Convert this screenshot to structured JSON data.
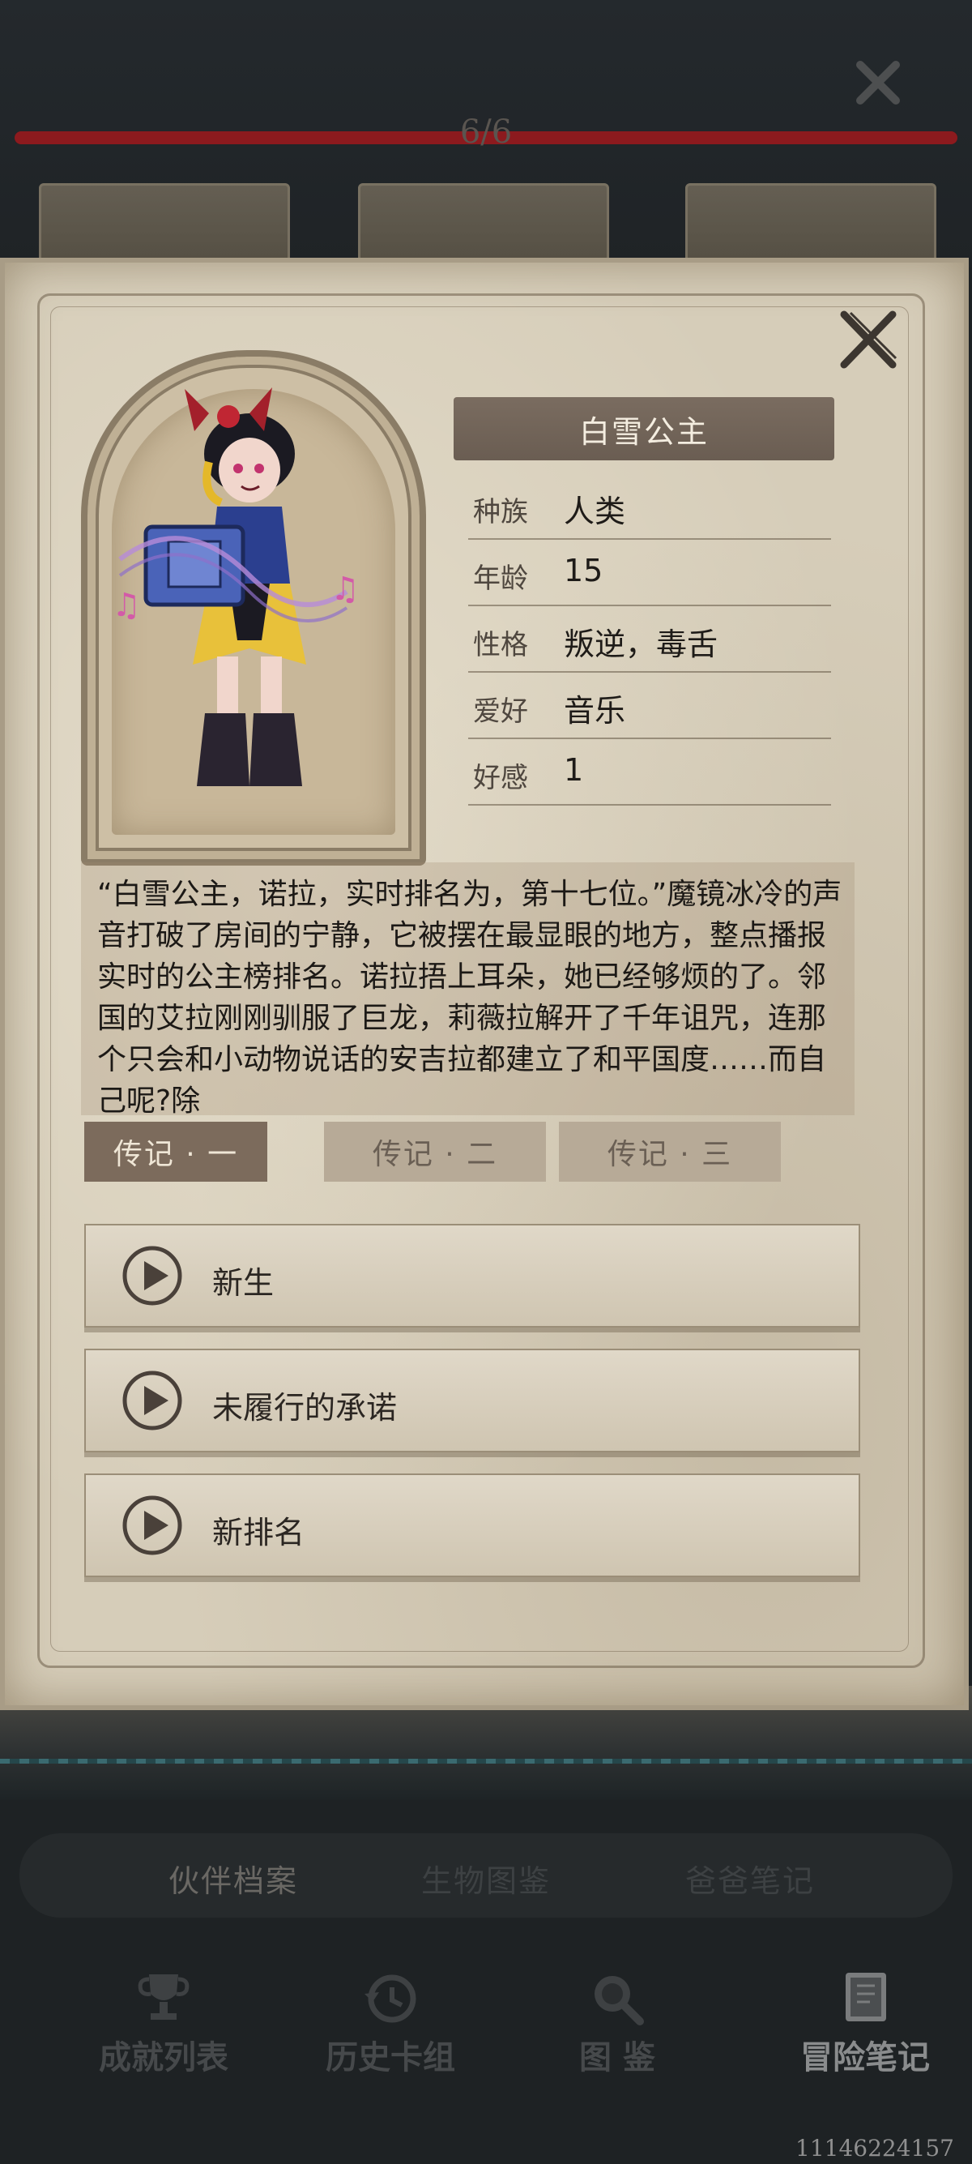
{
  "progress": {
    "text": "6/6",
    "fraction": 1.0
  },
  "character": {
    "name": "白雪公主",
    "attributes": [
      {
        "label": "种族",
        "value": "人类"
      },
      {
        "label": "年龄",
        "value": "15"
      },
      {
        "label": "性格",
        "value": "叛逆，毒舌"
      },
      {
        "label": "爱好",
        "value": "音乐"
      },
      {
        "label": "好感",
        "value": "1"
      }
    ],
    "story": "“白雪公主，诺拉，实时排名为，第十七位。”魔镜冰冷的声音打破了房间的宁静，它被摆在最显眼的地方，整点播报实时的公主榜排名。诺拉捂上耳朵，她已经够烦的了。邻国的艾拉刚刚驯服了巨龙，莉薇拉解开了千年诅咒，连那个只会和小动物说话的安吉拉都建立了和平国度……而自己呢?除"
  },
  "biography_tabs": [
    {
      "label": "传记 · 一",
      "active": true
    },
    {
      "label": "传记 · 二",
      "active": false
    },
    {
      "label": "传记 · 三",
      "active": false
    }
  ],
  "chapters": [
    {
      "label": "新生"
    },
    {
      "label": "未履行的承诺"
    },
    {
      "label": "新排名"
    }
  ],
  "sub_tabs": [
    {
      "label": "伙伴档案",
      "active": true
    },
    {
      "label": "生物图鉴",
      "active": false
    },
    {
      "label": "爸爸笔记",
      "active": false
    }
  ],
  "bottom_nav": [
    {
      "label": "成就列表",
      "icon": "trophy-icon",
      "active": false
    },
    {
      "label": "历史卡组",
      "icon": "history-icon",
      "active": false
    },
    {
      "label": "图 鉴",
      "icon": "magnifier-icon",
      "active": false
    },
    {
      "label": "冒险笔记",
      "icon": "notebook-icon",
      "active": true
    }
  ],
  "build_id": "11146224157",
  "colors": {
    "parchment": "#d6cdb9",
    "banner": "#6a5d52",
    "progress_fill": "#8c1a1e",
    "background": "#1d2124"
  }
}
